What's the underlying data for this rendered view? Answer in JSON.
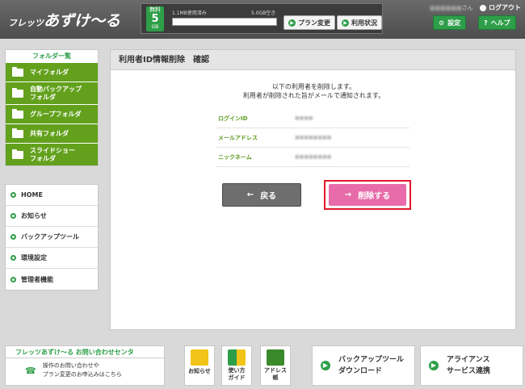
{
  "header": {
    "logo_small": "フレッツ",
    "logo_big": "あずけ〜る",
    "plan": {
      "badge_top": "無料",
      "badge_size": "5",
      "badge_unit": "GB",
      "usage_text": "1.1MB使用済み",
      "free_text": "5.0GB空き",
      "usage_fraction": 0.0
    },
    "plan_change_label": "プラン変更",
    "usage_status_label": "利用状況",
    "user_suffix": "さん",
    "logout_label": "ログアウト",
    "settings_label": "設定",
    "help_label": "ヘルプ"
  },
  "sidebar": {
    "folder_title": "フォルダ一覧",
    "folders": [
      {
        "label": "マイフォルダ"
      },
      {
        "label": "自動バックアップ\nフォルダ"
      },
      {
        "label": "グループフォルダ"
      },
      {
        "label": "共有フォルダ"
      },
      {
        "label": "スライドショー\nフォルダ"
      }
    ],
    "nav": [
      {
        "label": "HOME"
      },
      {
        "label": "お知らせ"
      },
      {
        "label": "バックアップツール"
      },
      {
        "label": "環境設定"
      },
      {
        "label": "管理者機能"
      }
    ]
  },
  "main": {
    "title": "利用者ID情報削除　確認",
    "message_line1": "以下の利用者を削除します。",
    "message_line2": "利用者が削除された旨がメールで通知されます。",
    "fields": [
      {
        "label": "ログインID",
        "value": "■■■■"
      },
      {
        "label": "メールアドレス",
        "value": "■■■■■■■■"
      },
      {
        "label": "ニックネーム",
        "value": "■■■■■■■■"
      }
    ],
    "back_label": "戻る",
    "delete_label": "削除する"
  },
  "footer": {
    "contact_title": "フレッツあずけ〜る お問い合わせセンタ",
    "contact_line1": "操作のお問い合わせや",
    "contact_line2": "プラン変更のお申込みはこちら",
    "notice_label": "お知らせ",
    "guide_label": "使い方\nガイド",
    "address_label": "アドレス\n帳",
    "backup_tool_label": "バックアップツール\nダウンロード",
    "alliance_label": "アライアンス\nサービス連携"
  },
  "colors": {
    "accent_green": "#2e9e49",
    "folder_green": "#63a11d",
    "delete_pink": "#e86caa",
    "highlight_red": "#e0192a",
    "back_gray": "#6e6e6e"
  }
}
